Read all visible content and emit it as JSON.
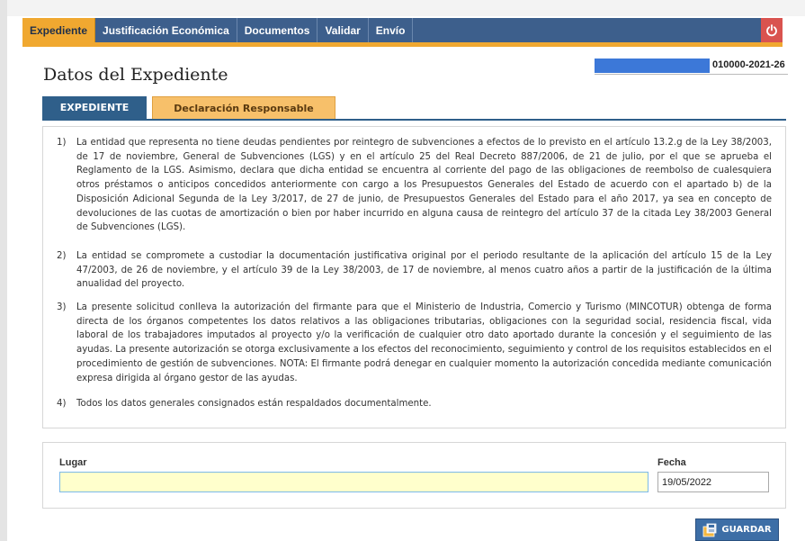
{
  "nav": {
    "tabs": [
      "Expediente",
      "Justificación Económica",
      "Documentos",
      "Validar",
      "Envío"
    ],
    "active": "Expediente"
  },
  "page": {
    "title": "Datos del Expediente",
    "expediente_code": "010000-2021-26"
  },
  "subtabs": {
    "expediente": "EXPEDIENTE",
    "declaracion": "Declaración Responsable"
  },
  "declaration": {
    "items": [
      {
        "num": "1)",
        "text": "La entidad que representa no tiene deudas pendientes por reintegro de subvenciones a efectos de lo previsto en el artículo 13.2.g de la Ley 38/2003, de 17 de noviembre, General de Subvenciones (LGS) y en el artículo 25 del Real Decreto 887/2006, de 21 de julio, por el que se aprueba el Reglamento de la LGS. Asimismo, declara que dicha entidad se encuentra al corriente del pago de las obligaciones de reembolso de cualesquiera otros préstamos o anticipos concedidos anteriormente con cargo a los Presupuestos Generales del Estado de acuerdo con el apartado b) de la Disposición Adicional Segunda de la Ley 3/2017, de 27 de junio, de Presupuestos Generales del Estado para el año 2017, ya sea en concepto de devoluciones de las cuotas de amortización o bien por haber incurrido en alguna causa de reintegro del artículo 37 de la citada Ley 38/2003 General de Subvenciones (LGS)."
      },
      {
        "num": "2)",
        "text": "La entidad se compromete a custodiar la documentación justificativa original por el periodo resultante de la aplicación del artículo 15 de la Ley 47/2003, de 26 de noviembre, y el artículo 39 de la Ley 38/2003, de 17 de noviembre, al menos cuatro años a partir de la justificación de la última anualidad del proyecto."
      },
      {
        "num": "3)",
        "text": "La presente solicitud conlleva la autorización del firmante para que el Ministerio de Industria, Comercio y Turismo (MINCOTUR) obtenga de forma directa de los órganos competentes los datos relativos a las obligaciones tributarias, obligaciones con la seguridad social, residencia fiscal, vida laboral de los trabajadores imputados al proyecto y/o la verificación de cualquier otro dato aportado durante la concesión y el seguimiento de las ayudas. La presente autorización se otorga exclusivamente a los efectos del reconocimiento, seguimiento y control de los requisitos establecidos en el procedimiento de gestión de subvenciones. NOTA: El firmante podrá denegar en cualquier momento la autorización concedida mediante comunicación expresa dirigida al órgano gestor de las ayudas."
      },
      {
        "num": "4)",
        "text": "Todos los datos generales consignados están respaldados documentalmente."
      }
    ]
  },
  "form": {
    "lugar_label": "Lugar",
    "lugar_value": "",
    "fecha_label": "Fecha",
    "fecha_value": "19/05/2022"
  },
  "actions": {
    "save_label": "GUARDAR"
  },
  "icons": {
    "power": "power-icon",
    "save": "save-icon"
  },
  "colors": {
    "nav_bg": "#3d5f8c",
    "accent": "#f0a830",
    "subtab_active": "#2f5f8a",
    "subtab_orange": "#f7c06a",
    "input_highlight": "#ffffcc",
    "power": "#d9534f"
  }
}
